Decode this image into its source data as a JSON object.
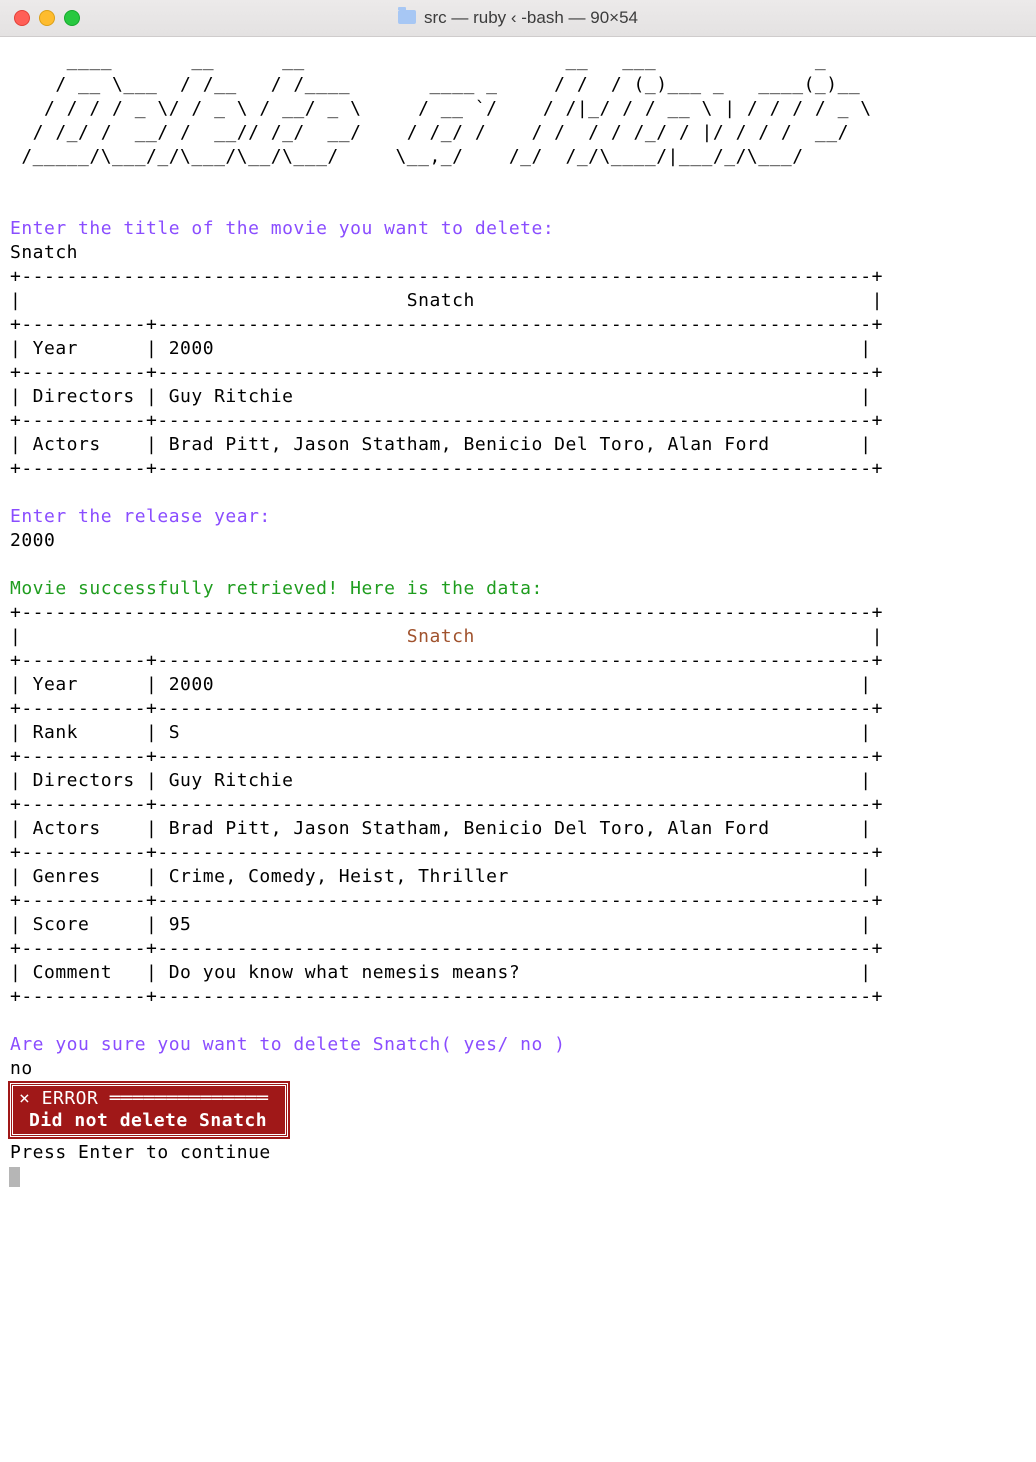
{
  "window": {
    "title": "src — ruby ‹ -bash — 90×54"
  },
  "ascii_art": "     ____       __      __                       __   ___              _\n    / __ \\___  / /__   / /____       ____ _     / /  / (_)___ _   ____(_)__\n   / / / / _ \\/ / _ \\ / __/ _ \\     / __ `/    / /|_/ / / __ \\ | / / / / _ \\\n  / /_/ /  __/ /  __// /_/  __/    / /_/ /    / /  / / /_/ / |/ / / /  __/\n /_____/\\___/_/\\___/\\__/\\___/     \\__,_/    /_/  /_/\\____/|___/_/\\___/",
  "prompt1": {
    "label": "Enter the title of the movie you want to delete:",
    "input": "Snatch"
  },
  "table1": {
    "title": "Snatch",
    "border_top": "+---------------------------------------------------------------------------+",
    "border_sep": "+-----------+---------------------------------------------------------------+",
    "rows": [
      {
        "key": "Year",
        "value": "2000"
      },
      {
        "key": "Directors",
        "value": "Guy Ritchie"
      },
      {
        "key": "Actors",
        "value": "Brad Pitt, Jason Statham, Benicio Del Toro, Alan Ford"
      }
    ]
  },
  "prompt2": {
    "label": "Enter the release year:",
    "input": "2000"
  },
  "success_line": "Movie successfully retrieved! Here is the data:",
  "table2": {
    "title": "Snatch",
    "rows": [
      {
        "key": "Year",
        "value": "2000"
      },
      {
        "key": "Rank",
        "value": "S"
      },
      {
        "key": "Directors",
        "value": "Guy Ritchie"
      },
      {
        "key": "Actors",
        "value": "Brad Pitt, Jason Statham, Benicio Del Toro, Alan Ford"
      },
      {
        "key": "Genres",
        "value": "Crime, Comedy, Heist, Thriller"
      },
      {
        "key": "Score",
        "value": "95"
      },
      {
        "key": "Comment",
        "value": "Do you know what nemesis means?"
      }
    ]
  },
  "confirm": {
    "label": "Are you sure you want to delete Snatch( yes/ no )",
    "input": "no"
  },
  "error_box": {
    "header": "× ERROR",
    "message": "Did not delete Snatch"
  },
  "continue_label": "Press Enter to continue"
}
